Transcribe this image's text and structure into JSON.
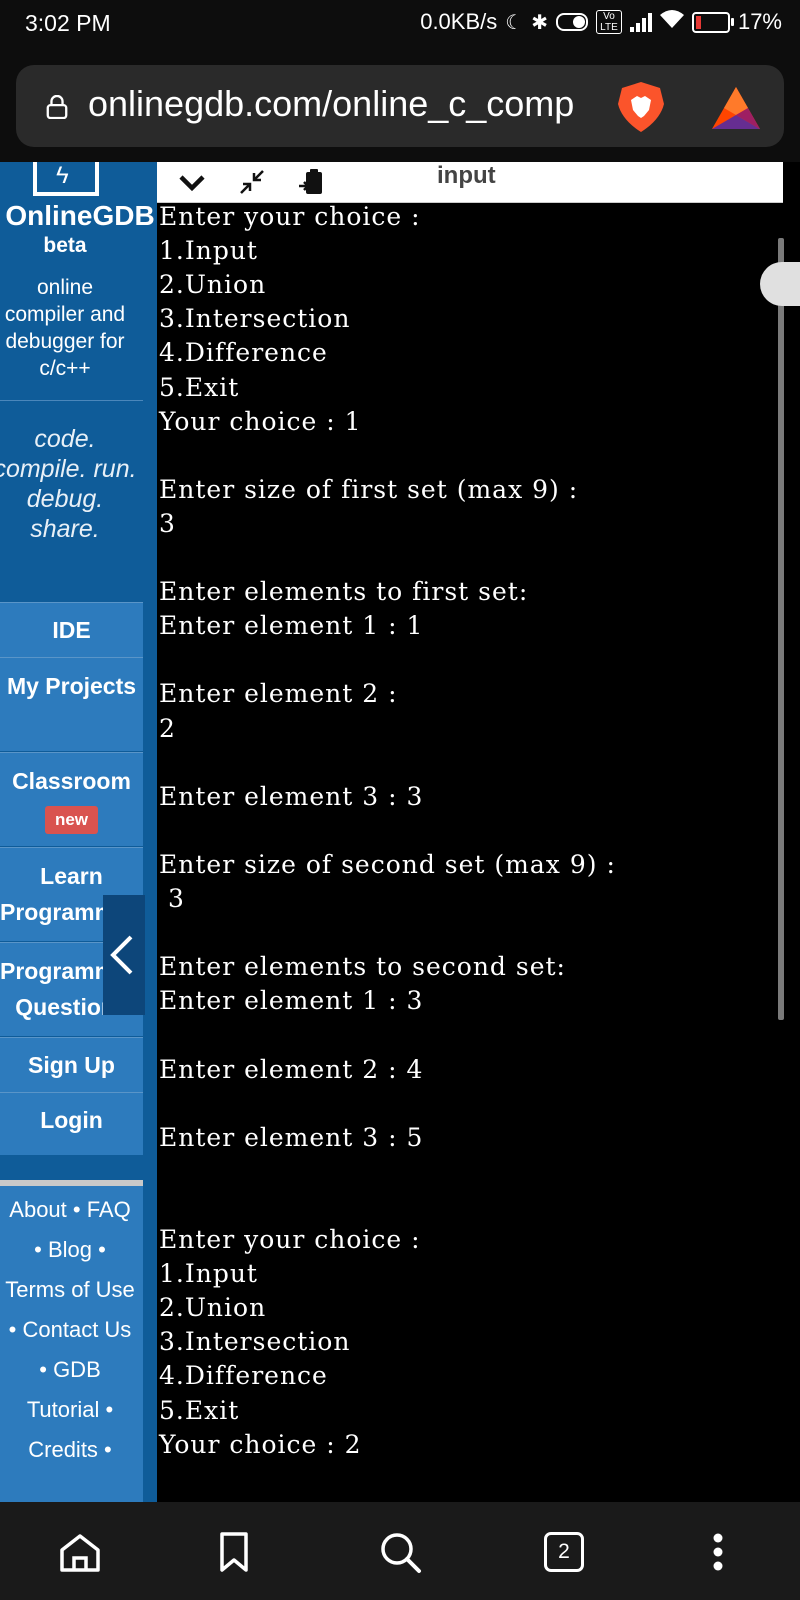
{
  "status_bar": {
    "time": "3:02 PM",
    "network_speed": "0.0KB/s",
    "volte": "Vo LTE",
    "battery": "17%"
  },
  "browser": {
    "url": "onlinegdb.com/online_c_comp",
    "icons": [
      "lock-icon",
      "brave-shield-icon",
      "brave-rewards-icon"
    ]
  },
  "sidebar": {
    "brand": "OnlineGDB",
    "beta": "beta",
    "description": [
      "online",
      "compiler and",
      "debugger for",
      "c/c++"
    ],
    "tagline": [
      "code.",
      "compile. run.",
      "debug.",
      "share."
    ],
    "nav": [
      {
        "id": "ide",
        "label": "IDE"
      },
      {
        "id": "my-projects",
        "label": "My Projects"
      },
      {
        "id": "classroom",
        "label": "Classroom",
        "badge": "new"
      },
      {
        "id": "learn-programming",
        "label": "Learn Programming"
      },
      {
        "id": "programming-questions",
        "label": "Programming Questions"
      },
      {
        "id": "sign-up",
        "label": "Sign Up"
      },
      {
        "id": "login",
        "label": "Login"
      }
    ],
    "footer": [
      "About • FAQ",
      "• Blog •",
      "Terms of Use",
      "• Contact Us",
      "• GDB",
      "Tutorial •",
      "Credits •"
    ]
  },
  "toolbar": {
    "title": "input",
    "icons": [
      "chevron-down-icon",
      "minimize-icon",
      "clipboard-icon"
    ]
  },
  "terminal": {
    "lines": [
      "Enter your choice :",
      "1.Input",
      "2.Union",
      "3.Intersection",
      "4.Difference",
      "5.Exit",
      "Your choice : 1",
      "",
      "Enter size of first set (max 9) :",
      "3",
      "",
      "Enter elements to first set:",
      "Enter element 1 : 1",
      "",
      "Enter element 2 :",
      "2",
      "",
      "Enter element 3 : 3",
      "",
      "Enter size of second set (max 9) :",
      " 3",
      "",
      "Enter elements to second set:",
      "Enter element 1 : 3",
      "",
      "Enter element 2 : 4",
      "",
      "Enter element 3 : 5",
      "",
      "",
      "Enter your choice :",
      "1.Input",
      "2.Union",
      "3.Intersection",
      "4.Difference",
      "5.Exit",
      "Your choice : 2"
    ]
  },
  "bottom_nav": {
    "tab_count": "2",
    "icons": [
      "home-icon",
      "bookmark-icon",
      "search-icon",
      "tabs-icon",
      "more-icon"
    ]
  }
}
